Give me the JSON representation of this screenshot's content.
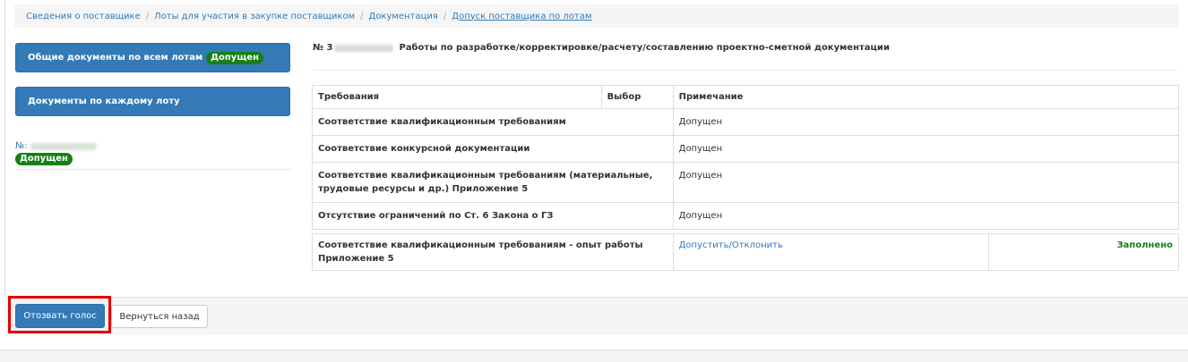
{
  "breadcrumb": [
    "Сведения о поставщике",
    "Лоты для участия в закупке поставщиком",
    "Документация",
    "Допуск поставщика по лотам"
  ],
  "breadcrumb_separator": "/",
  "sidebar": {
    "common_docs_label": "Общие документы по всем лотам",
    "common_docs_badge": "Допущен",
    "per_lot_docs_label": "Документы по каждому лоту",
    "lot_number_prefix": "№:",
    "lot_badge": "Допущен"
  },
  "lot": {
    "number_prefix": "№ 3",
    "title": "Работы по разработке/корректировке/расчету/составлению проектно-сметной документации"
  },
  "requirements_table": {
    "headers": [
      "Требования",
      "Выбор",
      "Примечание"
    ],
    "rows": [
      {
        "requirement": "Соответствие квалификационным требованиям",
        "choice": "",
        "note": "Допущен"
      },
      {
        "requirement": "Соответствие конкурсной документации",
        "choice": "",
        "note": "Допущен"
      },
      {
        "requirement": "Соответствие квалификационным требованиям (материальные, трудовые ресурсы и др.) Приложение 5",
        "choice": "",
        "note": "Допущен"
      },
      {
        "requirement": "Отсутствие ограничений по Ст. 6 Закона о ГЗ",
        "choice": "",
        "note": "Допущен"
      }
    ]
  },
  "experience_table": {
    "requirement": "Соответствие квалификационным требованиям - опыт работы Приложение 5",
    "action_link": "Допустить/Отклонить",
    "status": "Заполнено"
  },
  "footer": {
    "revoke_label": "Отозвать голос",
    "back_label": "Вернуться назад"
  },
  "colors": {
    "primary": "#337ab7",
    "success": "#167f16",
    "highlight": "#e00000"
  }
}
